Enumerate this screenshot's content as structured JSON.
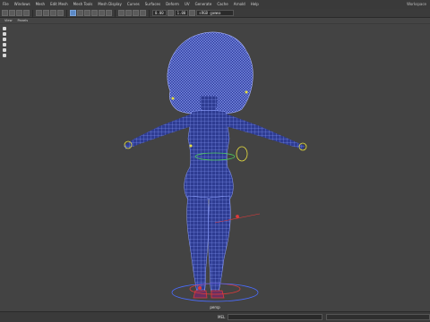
{
  "menubar": {
    "items": [
      "File",
      "Windows",
      "Mesh",
      "Edit Mesh",
      "Mesh Tools",
      "Mesh Display",
      "Curves",
      "Surfaces",
      "Deform",
      "UV",
      "Generate",
      "Cache",
      "Arnold",
      "Help"
    ],
    "app_title": "Workspace"
  },
  "statusline": {
    "field_a": "0.00",
    "field_b": "1.00",
    "field_c": "sRGB gamma"
  },
  "panel_menu": {
    "items": [
      "View",
      "Panels"
    ]
  },
  "viewport": {
    "camera_label": "persp",
    "background": "#434343",
    "mesh_color": "#2f3f9a",
    "wire_color": "#8aa0ff",
    "control_yellow": "#e8e040",
    "control_green": "#4cc85a",
    "control_red": "#e03a3a",
    "control_blue": "#4a6cff"
  },
  "command_line": {
    "language": "MEL"
  }
}
